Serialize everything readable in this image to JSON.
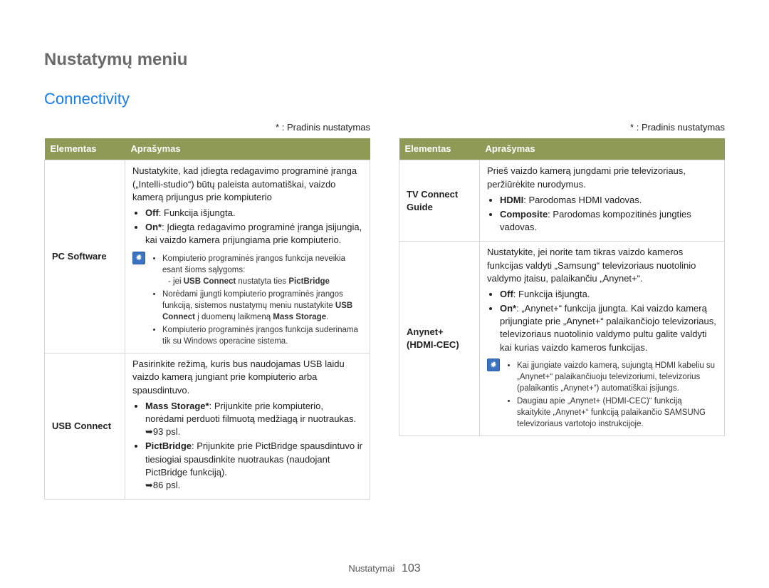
{
  "pageTitle": "Nustatymų meniu",
  "sectionTitle": "Connectivity",
  "legend": "* : Pradinis nustatymas",
  "headers": {
    "elem": "Elementas",
    "desc": "Aprašymas"
  },
  "left": {
    "pcSoftware": {
      "name": "PC Software",
      "intro": "Nustatykite, kad įdiegta redagavimo programinė įranga („Intelli-studio“) būtų paleista automatiškai, vaizdo kamerą prijungus prie kompiuterio",
      "off_b": "Off",
      "off_t": ": Funkcija išjungta.",
      "on_b": "On*",
      "on_t": ": Įdiegta redagavimo programinė įranga įsijungia, kai vaizdo kamera prijungiama prie kompiuterio.",
      "note1": "Kompiuterio programinės įrangos funkcija neveikia esant šioms sąlygoms:",
      "note1a_pre": "- jei ",
      "note1a_b1": "USB Connect",
      "note1a_mid": " nustatyta ties ",
      "note1a_b2": "PictBridge",
      "note2_pre": "Norėdami įjungti kompiuterio programinės įrangos funkciją, sistemos nustatymų meniu nustatykite ",
      "note2_b1": "USB Connect",
      "note2_mid": " į duomenų laikmeną ",
      "note2_b2": "Mass Storage",
      "note2_post": ".",
      "note3": "Kompiuterio programinės įrangos funkcija suderinama tik su Windows operacine sistema."
    },
    "usbConnect": {
      "name": "USB Connect",
      "intro": "Pasirinkite režimą, kuris bus naudojamas USB laidu vaizdo kamerą jungiant prie kompiuterio arba spausdintuvo.",
      "ms_b": "Mass Storage*",
      "ms_t": ": Prijunkite prie kompiuterio, norėdami perduoti filmuotą medžiagą ir nuotraukas. ",
      "ms_ref": "➥93 psl.",
      "pb_b": "PictBridge",
      "pb_t": ": Prijunkite prie PictBridge spausdintuvo ir tiesiogiai spausdinkite nuotraukas (naudojant PictBridge funkciją). ",
      "pb_ref": "➥86 psl."
    }
  },
  "right": {
    "tvConnect": {
      "name": "TV Connect Guide",
      "intro": "Prieš vaizdo kamerą jungdami prie televizoriaus, peržiūrėkite nurodymus.",
      "hdmi_b": "HDMI",
      "hdmi_t": ": Parodomas HDMI vadovas.",
      "comp_b": "Composite",
      "comp_t": ": Parodomas kompozitinės jungties vadovas."
    },
    "anynet": {
      "name": "Anynet+ (HDMI-CEC)",
      "intro": "Nustatykite, jei norite tam tikras vaizdo kameros funkcijas valdyti „Samsung“ televizoriaus nuotolinio valdymo įtaisu, palaikančiu „Anynet+“.",
      "off_b": "Off",
      "off_t": ": Funkcija išjungta.",
      "on_b": "On*",
      "on_t": ": „Anynet+“ funkcija įjungta. Kai vaizdo kamerą prijungiate prie „Anynet+“ palaikančiojo televizoriaus, televizoriaus nuotolinio valdymo pultu galite valdyti kai kurias vaizdo kameros funkcijas.",
      "note1": "Kai įjungiate vaizdo kamerą, sujungtą HDMI kabeliu su „Anynet+“ palaikančiuoju televizoriumi, televizorius (palaikantis „Anynet+“) automatiškai įsijungs.",
      "note2": "Daugiau apie „Anynet+ (HDMI-CEC)“ funkciją skaitykite „Anynet+“ funkciją palaikančio SAMSUNG televizoriaus vartotojo instrukcijoje."
    }
  },
  "footer": {
    "label": "Nustatymai",
    "page": "103"
  }
}
